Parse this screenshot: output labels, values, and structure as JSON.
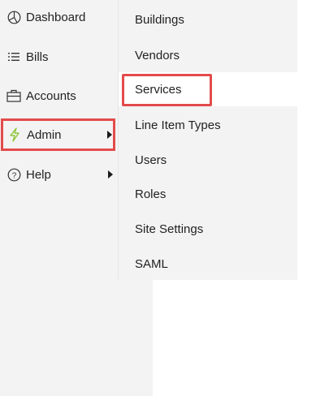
{
  "nav": {
    "items": [
      {
        "label": "Dashboard",
        "icon": "dashboard-icon"
      },
      {
        "label": "Bills",
        "icon": "list-icon"
      },
      {
        "label": "Accounts",
        "icon": "briefcase-icon"
      },
      {
        "label": "Admin",
        "icon": "bolt-icon",
        "accent": "#8fc63d"
      },
      {
        "label": "Help",
        "icon": "help-circle-icon"
      }
    ]
  },
  "submenu": {
    "items": [
      {
        "label": "Buildings"
      },
      {
        "label": "Vendors"
      },
      {
        "label": "Services"
      },
      {
        "label": "Line Item Types"
      },
      {
        "label": "Users"
      },
      {
        "label": "Roles"
      },
      {
        "label": "Site Settings"
      },
      {
        "label": "SAML"
      }
    ]
  },
  "colors": {
    "highlight": "#e34b4b",
    "sidebar_bg": "#f3f3f3"
  }
}
